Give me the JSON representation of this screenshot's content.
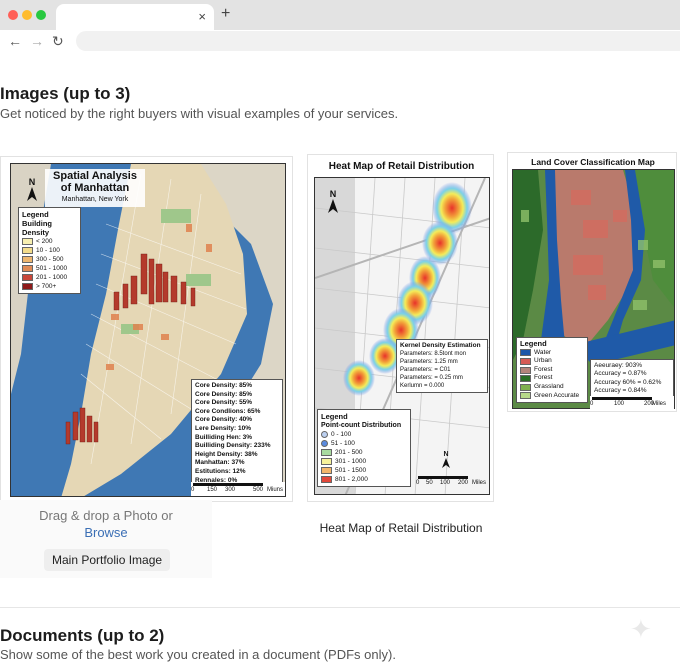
{
  "browser": {
    "close_glyph": "×",
    "newtab_glyph": "+",
    "back_glyph": "←",
    "forward_glyph": "→",
    "reload_glyph": "↻"
  },
  "images_section": {
    "title": "Images (up to 3)",
    "subtitle": "Get noticed by the right buyers with visual examples of your services.",
    "upload": {
      "drop_text": "Drag & drop a Photo or",
      "browse_link": "Browse",
      "main_label": "Main Portfolio Image"
    },
    "caption_2": "Heat Map of Retail Distribution"
  },
  "map1": {
    "title_line1": "Spatial Analysis",
    "title_line2": "of Manhattan",
    "subtitle": "Manhattan, New York",
    "north": "N",
    "legend_title": "Legend",
    "legend_subtitle": "Building Density",
    "legend_items": [
      {
        "label": "< 200",
        "color": "#f7efb0"
      },
      {
        "label": "10 - 100",
        "color": "#f3dc8a"
      },
      {
        "label": "300 - 500",
        "color": "#eeb66e"
      },
      {
        "label": "501 - 1000",
        "color": "#e08a55"
      },
      {
        "label": "201 - 1000",
        "color": "#c9473a"
      },
      {
        "label": "> 700+",
        "color": "#8e1a1a"
      }
    ],
    "stats": [
      "Core Density: 85%",
      "Core Density: 85%",
      "Core Density: 55%",
      "Core Condlions: 65%",
      "Core Density: 40%",
      "Lere Density: 10%",
      "Builliding Hen: 3%",
      "Builliding Density: 233%",
      "Height Density: 38%",
      "Manhattan: 37%",
      "Estitutions: 12%",
      "Rennales: 0%"
    ],
    "scale_labels": [
      "0",
      "150",
      "300",
      "500"
    ],
    "scale_unit": "Miuns"
  },
  "map2": {
    "title": "Heat Map of Retail Distribution",
    "north": "N",
    "kde_title": "Kernel Density Estimation",
    "kde_lines": [
      "Parameters: 8.5tont mon",
      "Parameters: 1.25 mm",
      "Parameters: = C01",
      "Parameters: = 0.25 mm",
      "Kerlumn = 0.000"
    ],
    "legend_title": "Legend",
    "legend_subtitle": "Point-count Distribution",
    "legend_items": [
      {
        "label": "0 - 100",
        "color": "#bcd0f0"
      },
      {
        "label": "51 - 100",
        "color": "#5a8be0"
      },
      {
        "label": "201 - 500",
        "color": "#a9dba0"
      },
      {
        "label": "301 - 1000",
        "color": "#f6f29a"
      },
      {
        "label": "501 - 1500",
        "color": "#f4b76a"
      },
      {
        "label": "801 - 2,000",
        "color": "#e2483a"
      }
    ],
    "scale_labels": [
      "0",
      "50",
      "100",
      "200"
    ],
    "scale_unit": "Miles"
  },
  "map3": {
    "title": "Land Cover Classification Map",
    "legend_title": "Legend",
    "legend_items": [
      {
        "label": "Water",
        "color": "#1c56a8"
      },
      {
        "label": "Urban",
        "color": "#d65b55"
      },
      {
        "label": "Forest",
        "color": "#b4847a"
      },
      {
        "label": "Forest",
        "color": "#2a6e24"
      },
      {
        "label": "Grassland",
        "color": "#7fb04e"
      },
      {
        "label": "Green Accurate",
        "color": "#b7d88a"
      }
    ],
    "accuracy_lines": [
      "Aeeuraey: 903%",
      "Accuracy = 0.87%",
      "Accuracy 60% = 0.62%",
      "Accuracy = 0.84%"
    ],
    "scale_labels": [
      "0",
      "100",
      "200"
    ],
    "scale_unit": "Miles"
  },
  "documents_section": {
    "title": "Documents (up to 2)",
    "subtitle": "Show some of the best work you created in a document (PDFs only)."
  }
}
